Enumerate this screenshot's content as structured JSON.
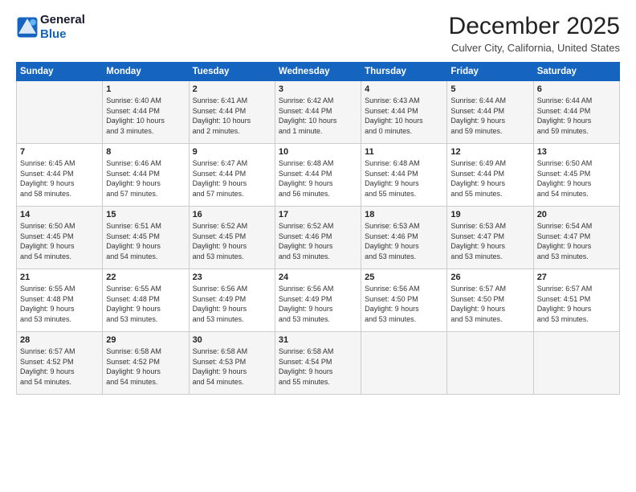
{
  "logo": {
    "line1": "General",
    "line2": "Blue"
  },
  "title": "December 2025",
  "location": "Culver City, California, United States",
  "days_of_week": [
    "Sunday",
    "Monday",
    "Tuesday",
    "Wednesday",
    "Thursday",
    "Friday",
    "Saturday"
  ],
  "weeks": [
    [
      {
        "num": "",
        "info": ""
      },
      {
        "num": "1",
        "info": "Sunrise: 6:40 AM\nSunset: 4:44 PM\nDaylight: 10 hours\nand 3 minutes."
      },
      {
        "num": "2",
        "info": "Sunrise: 6:41 AM\nSunset: 4:44 PM\nDaylight: 10 hours\nand 2 minutes."
      },
      {
        "num": "3",
        "info": "Sunrise: 6:42 AM\nSunset: 4:44 PM\nDaylight: 10 hours\nand 1 minute."
      },
      {
        "num": "4",
        "info": "Sunrise: 6:43 AM\nSunset: 4:44 PM\nDaylight: 10 hours\nand 0 minutes."
      },
      {
        "num": "5",
        "info": "Sunrise: 6:44 AM\nSunset: 4:44 PM\nDaylight: 9 hours\nand 59 minutes."
      },
      {
        "num": "6",
        "info": "Sunrise: 6:44 AM\nSunset: 4:44 PM\nDaylight: 9 hours\nand 59 minutes."
      }
    ],
    [
      {
        "num": "7",
        "info": "Sunrise: 6:45 AM\nSunset: 4:44 PM\nDaylight: 9 hours\nand 58 minutes."
      },
      {
        "num": "8",
        "info": "Sunrise: 6:46 AM\nSunset: 4:44 PM\nDaylight: 9 hours\nand 57 minutes."
      },
      {
        "num": "9",
        "info": "Sunrise: 6:47 AM\nSunset: 4:44 PM\nDaylight: 9 hours\nand 57 minutes."
      },
      {
        "num": "10",
        "info": "Sunrise: 6:48 AM\nSunset: 4:44 PM\nDaylight: 9 hours\nand 56 minutes."
      },
      {
        "num": "11",
        "info": "Sunrise: 6:48 AM\nSunset: 4:44 PM\nDaylight: 9 hours\nand 55 minutes."
      },
      {
        "num": "12",
        "info": "Sunrise: 6:49 AM\nSunset: 4:44 PM\nDaylight: 9 hours\nand 55 minutes."
      },
      {
        "num": "13",
        "info": "Sunrise: 6:50 AM\nSunset: 4:45 PM\nDaylight: 9 hours\nand 54 minutes."
      }
    ],
    [
      {
        "num": "14",
        "info": "Sunrise: 6:50 AM\nSunset: 4:45 PM\nDaylight: 9 hours\nand 54 minutes."
      },
      {
        "num": "15",
        "info": "Sunrise: 6:51 AM\nSunset: 4:45 PM\nDaylight: 9 hours\nand 54 minutes."
      },
      {
        "num": "16",
        "info": "Sunrise: 6:52 AM\nSunset: 4:45 PM\nDaylight: 9 hours\nand 53 minutes."
      },
      {
        "num": "17",
        "info": "Sunrise: 6:52 AM\nSunset: 4:46 PM\nDaylight: 9 hours\nand 53 minutes."
      },
      {
        "num": "18",
        "info": "Sunrise: 6:53 AM\nSunset: 4:46 PM\nDaylight: 9 hours\nand 53 minutes."
      },
      {
        "num": "19",
        "info": "Sunrise: 6:53 AM\nSunset: 4:47 PM\nDaylight: 9 hours\nand 53 minutes."
      },
      {
        "num": "20",
        "info": "Sunrise: 6:54 AM\nSunset: 4:47 PM\nDaylight: 9 hours\nand 53 minutes."
      }
    ],
    [
      {
        "num": "21",
        "info": "Sunrise: 6:55 AM\nSunset: 4:48 PM\nDaylight: 9 hours\nand 53 minutes."
      },
      {
        "num": "22",
        "info": "Sunrise: 6:55 AM\nSunset: 4:48 PM\nDaylight: 9 hours\nand 53 minutes."
      },
      {
        "num": "23",
        "info": "Sunrise: 6:56 AM\nSunset: 4:49 PM\nDaylight: 9 hours\nand 53 minutes."
      },
      {
        "num": "24",
        "info": "Sunrise: 6:56 AM\nSunset: 4:49 PM\nDaylight: 9 hours\nand 53 minutes."
      },
      {
        "num": "25",
        "info": "Sunrise: 6:56 AM\nSunset: 4:50 PM\nDaylight: 9 hours\nand 53 minutes."
      },
      {
        "num": "26",
        "info": "Sunrise: 6:57 AM\nSunset: 4:50 PM\nDaylight: 9 hours\nand 53 minutes."
      },
      {
        "num": "27",
        "info": "Sunrise: 6:57 AM\nSunset: 4:51 PM\nDaylight: 9 hours\nand 53 minutes."
      }
    ],
    [
      {
        "num": "28",
        "info": "Sunrise: 6:57 AM\nSunset: 4:52 PM\nDaylight: 9 hours\nand 54 minutes."
      },
      {
        "num": "29",
        "info": "Sunrise: 6:58 AM\nSunset: 4:52 PM\nDaylight: 9 hours\nand 54 minutes."
      },
      {
        "num": "30",
        "info": "Sunrise: 6:58 AM\nSunset: 4:53 PM\nDaylight: 9 hours\nand 54 minutes."
      },
      {
        "num": "31",
        "info": "Sunrise: 6:58 AM\nSunset: 4:54 PM\nDaylight: 9 hours\nand 55 minutes."
      },
      {
        "num": "",
        "info": ""
      },
      {
        "num": "",
        "info": ""
      },
      {
        "num": "",
        "info": ""
      }
    ]
  ]
}
